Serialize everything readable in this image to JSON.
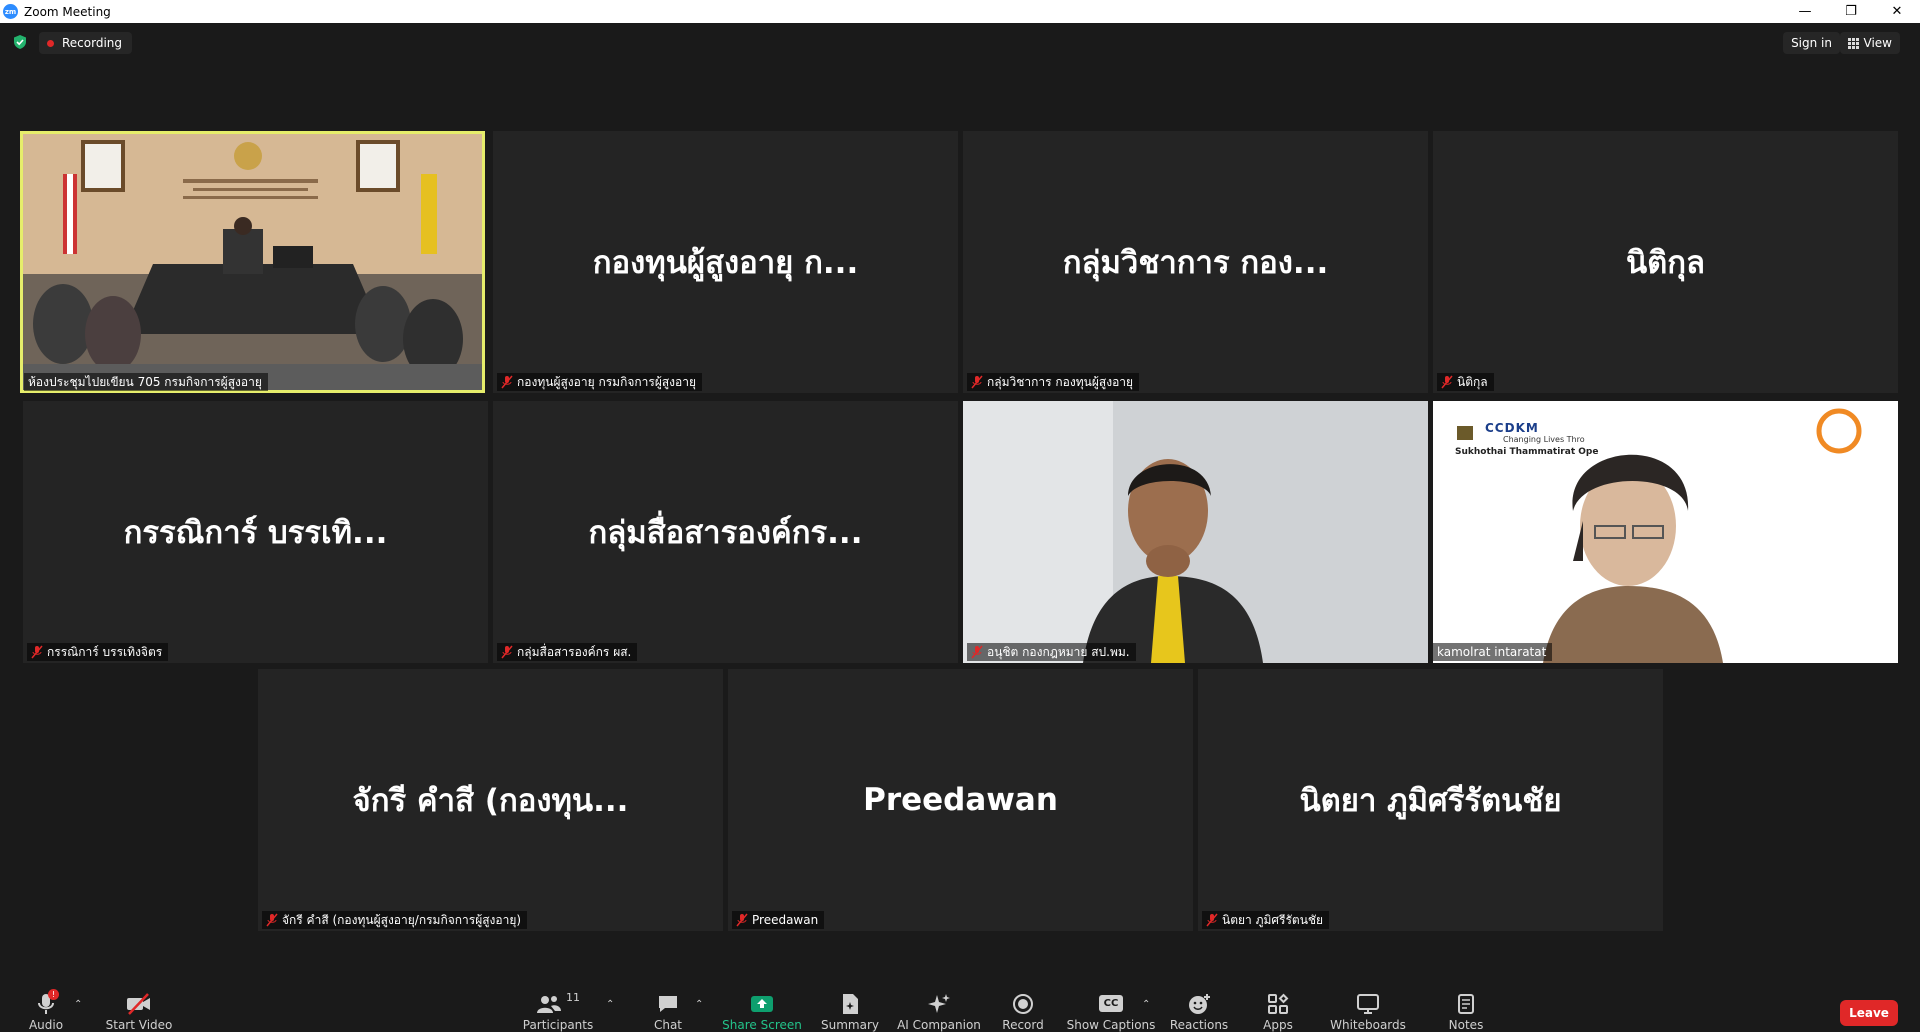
{
  "window": {
    "title": "Zoom Meeting",
    "logo_text": "zm"
  },
  "topbar": {
    "recording_label": "Recording",
    "signin_label": "Sign in",
    "view_label": "View"
  },
  "tiles": [
    {
      "big_name": "",
      "label": "ห้องประชุมไปยเขียน 705 กรมกิจการผู้สูงอายุ",
      "video": "conference-room"
    },
    {
      "big_name": "กองทุนผู้สูงอายุ ก...",
      "label": "กองทุนผู้สูงอายุ กรมกิจการผู้สูงอายุ"
    },
    {
      "big_name": "กลุ่มวิชาการ กอง...",
      "label": "กลุ่มวิชาการ กองทุนผู้สูงอายุ"
    },
    {
      "big_name": "นิติกุล",
      "label": "นิติกุล"
    },
    {
      "big_name": "กรรณิการ์ บรรเทิ...",
      "label": "กรรณิการ์ บรรเทิงจิตร"
    },
    {
      "big_name": "กลุ่มสื่อสารองค์กร...",
      "label": "กลุ่มสื่อสารองค์กร ผส."
    },
    {
      "big_name": "",
      "label": "อนุชิต กองกฎหมาย สป.พม.",
      "video": "person"
    },
    {
      "big_name": "",
      "label": "kamolrat intaratat",
      "video": "person-logo",
      "logo_text": "CCDKM",
      "logo_sub1": "Changing Lives Thro",
      "logo_sub2": "Sukhothai Thammatirat Ope"
    },
    {
      "big_name": "จักรี คำสี (กองทุน...",
      "label": "จักรี คำสี (กองทุนผู้สูงอายุ/กรมกิจการผู้สูงอายุ)"
    },
    {
      "big_name": "Preedawan",
      "label": "Preedawan"
    },
    {
      "big_name": "นิตยา ภูมิศรีรัตนชัย",
      "label": "นิตยา ภูมิศรีรัตนชัย"
    }
  ],
  "toolbar": {
    "audio": "Audio",
    "start_video": "Start Video",
    "participants": "Participants",
    "participants_count": "11",
    "chat": "Chat",
    "share_screen": "Share Screen",
    "summary": "Summary",
    "ai_companion": "AI Companion",
    "record": "Record",
    "show_captions": "Show Captions",
    "reactions": "Reactions",
    "apps": "Apps",
    "whiteboards": "Whiteboards",
    "notes": "Notes",
    "leave": "Leave",
    "cc_text": "CC",
    "audio_alert": "!"
  },
  "colors": {
    "accent": "#2d8cff",
    "leave": "#e02828",
    "active_speaker": "#e6ed6b",
    "share_green": "#0e9f6e"
  }
}
